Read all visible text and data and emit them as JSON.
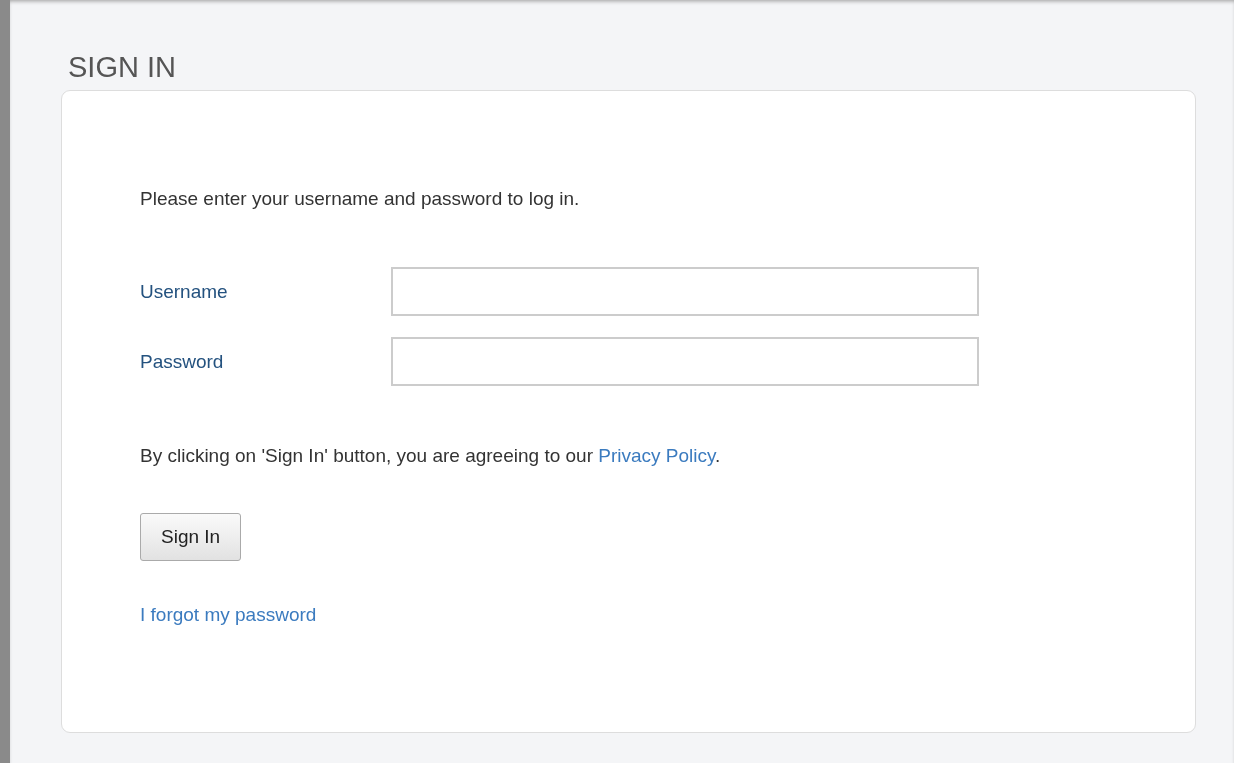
{
  "title": "SIGN IN",
  "intro": "Please enter your username and password to log in.",
  "fields": [
    {
      "label": "Username"
    },
    {
      "label": "Password"
    }
  ],
  "agreement": {
    "text": "By clicking on 'Sign In' button, you are agreeing to our ",
    "link": "Privacy Policy",
    "end": "."
  },
  "button": "Sign In",
  "forgot_link": "I forgot my password"
}
